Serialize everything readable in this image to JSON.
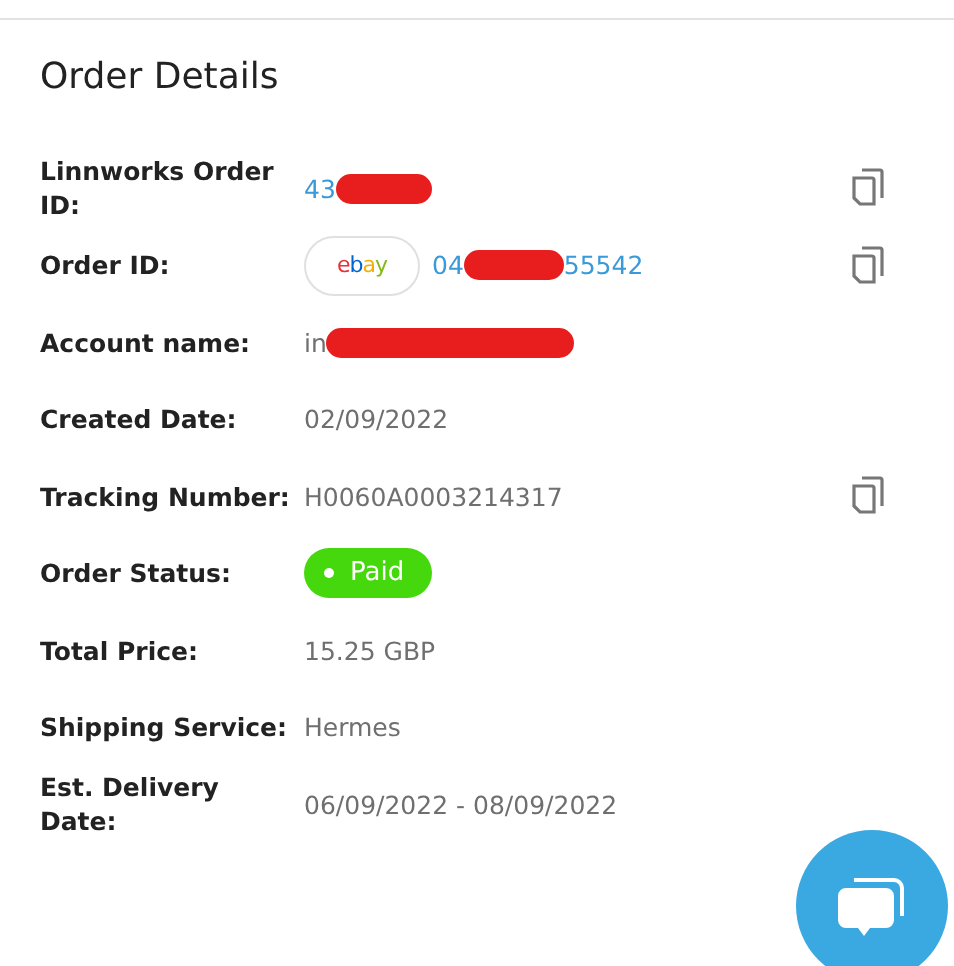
{
  "title": "Order Details",
  "rows": [
    {
      "label": "Linnworks Order ID:",
      "kind": "link",
      "parts": [
        {
          "kind": "text",
          "text": "43"
        },
        {
          "kind": "redacted"
        }
      ],
      "copy": true
    },
    {
      "label": "Order ID:",
      "kind": "link",
      "channel": "ebay",
      "parts": [
        {
          "kind": "text",
          "text": "04"
        },
        {
          "kind": "redacted"
        },
        {
          "kind": "text",
          "text": "55542"
        }
      ],
      "copy": true
    },
    {
      "label": "Account name:",
      "kind": "plain",
      "parts": [
        {
          "kind": "text",
          "text": "in"
        },
        {
          "kind": "redacted"
        }
      ],
      "copy": false
    },
    {
      "label": "Created Date:",
      "kind": "plain",
      "parts": [
        {
          "kind": "text",
          "text": "02/09/2022"
        }
      ],
      "copy": false
    },
    {
      "label": "Tracking Number:",
      "kind": "plain",
      "parts": [
        {
          "kind": "text",
          "text": "H0060A0003214317"
        }
      ],
      "copy": true
    },
    {
      "label": "Order Status:",
      "kind": "status",
      "parts": [
        {
          "kind": "text",
          "text": "Paid"
        }
      ],
      "copy": false
    },
    {
      "label": "Total Price:",
      "kind": "plain",
      "parts": [
        {
          "kind": "text",
          "text": "15.25 GBP"
        }
      ],
      "copy": false
    },
    {
      "label": "Shipping Service:",
      "kind": "plain",
      "parts": [
        {
          "kind": "text",
          "text": "Hermes"
        }
      ],
      "copy": false
    },
    {
      "label": "Est. Delivery Date:",
      "kind": "plain",
      "parts": [
        {
          "kind": "text",
          "text": "06/09/2022 - 08/09/2022"
        }
      ],
      "copy": false
    }
  ]
}
